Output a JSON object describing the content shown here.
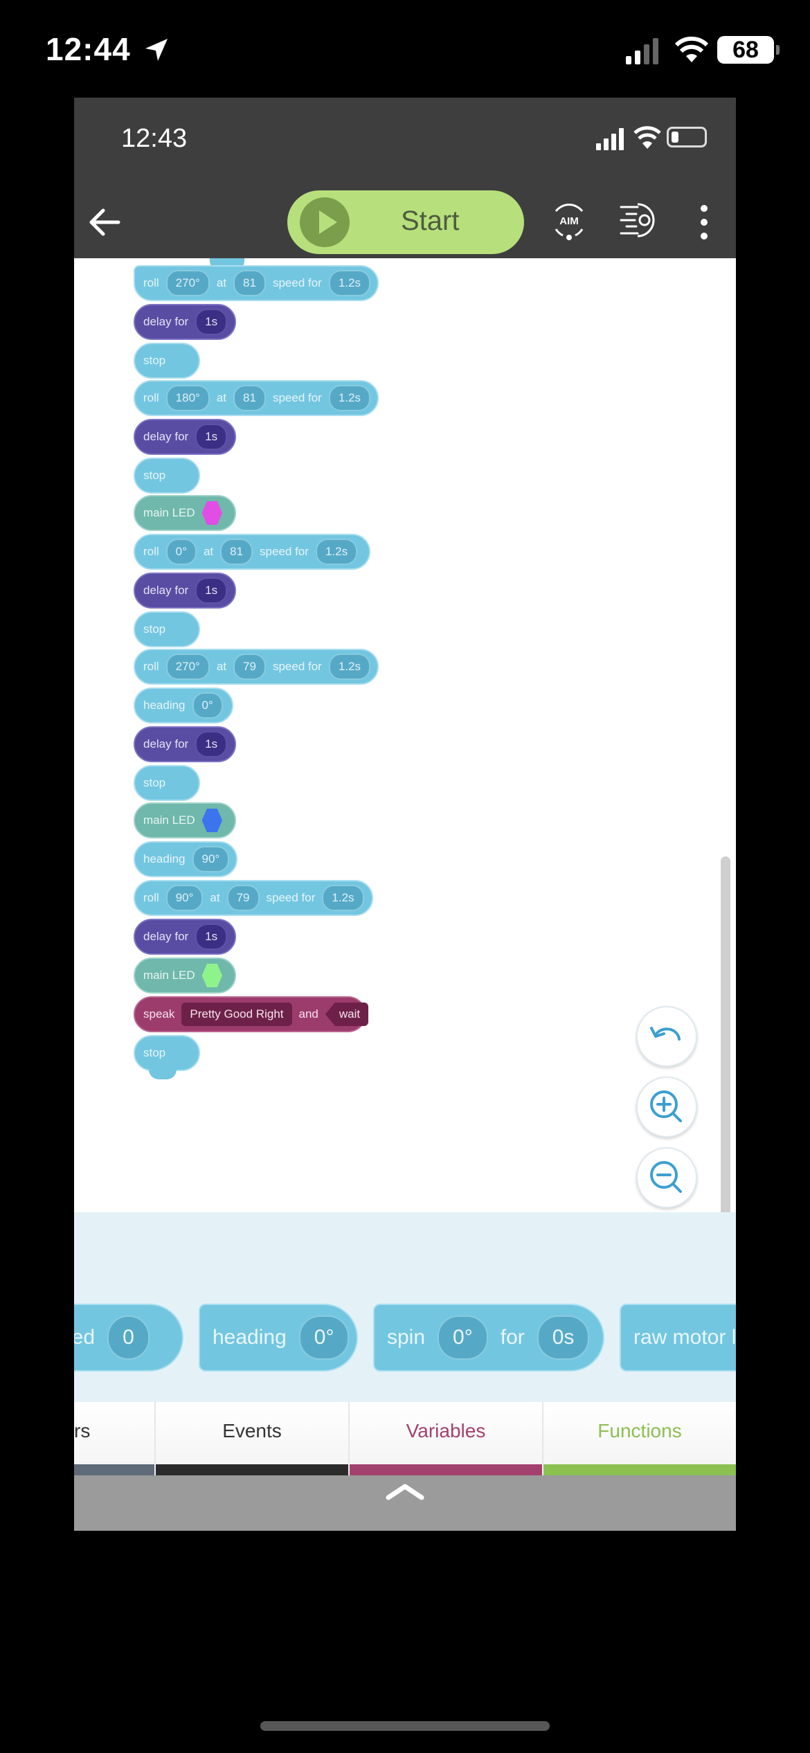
{
  "device_status": {
    "time": "12:44",
    "battery": "68",
    "location_icon": "location-arrow-icon",
    "signal_icon": "cell-signal-icon",
    "wifi_icon": "wifi-icon"
  },
  "app_status": {
    "time": "12:43"
  },
  "toolbar": {
    "back_icon": "back-arrow-icon",
    "start_label": "Start",
    "aim_label": "AIM",
    "gauge_icon": "sensor-gauge-icon",
    "more_icon": "more-vertical-icon"
  },
  "colors": {
    "roll": "#73c6e0",
    "delay": "#584ca3",
    "led": "#6fb8ab",
    "speak": "#9c3c6c",
    "led_magenta": "#e24de6",
    "led_blue": "#3b74ee",
    "led_green": "#8ff38c",
    "variables": "#a3416e",
    "functions": "#8cc051"
  },
  "blocks": [
    {
      "kind": "roll",
      "label": "roll",
      "heading": "270°",
      "at": "at",
      "speed": "81",
      "speed_label": "speed for",
      "duration": "1.2s"
    },
    {
      "kind": "delay",
      "label": "delay for",
      "value": "1s"
    },
    {
      "kind": "stop",
      "label": "stop"
    },
    {
      "kind": "roll",
      "label": "roll",
      "heading": "180°",
      "at": "at",
      "speed": "81",
      "speed_label": "speed for",
      "duration": "1.2s"
    },
    {
      "kind": "delay",
      "label": "delay for",
      "value": "1s"
    },
    {
      "kind": "stop",
      "label": "stop"
    },
    {
      "kind": "led",
      "label": "main LED",
      "color": "#e24de6"
    },
    {
      "kind": "roll",
      "label": "roll",
      "heading": "0°",
      "at": "at",
      "speed": "81",
      "speed_label": "speed for",
      "duration": "1.2s"
    },
    {
      "kind": "delay",
      "label": "delay for",
      "value": "1s"
    },
    {
      "kind": "stop",
      "label": "stop"
    },
    {
      "kind": "roll",
      "label": "roll",
      "heading": "270°",
      "at": "at",
      "speed": "79",
      "speed_label": "speed for",
      "duration": "1.2s"
    },
    {
      "kind": "heading",
      "label": "heading",
      "value": "0°"
    },
    {
      "kind": "delay",
      "label": "delay for",
      "value": "1s"
    },
    {
      "kind": "stop",
      "label": "stop"
    },
    {
      "kind": "led",
      "label": "main LED",
      "color": "#3b74ee"
    },
    {
      "kind": "heading",
      "label": "heading",
      "value": "90°"
    },
    {
      "kind": "roll",
      "label": "roll",
      "heading": "90°",
      "at": "at",
      "speed": "79",
      "speed_label": "speed for",
      "duration": "1.2s"
    },
    {
      "kind": "delay",
      "label": "delay for",
      "value": "1s"
    },
    {
      "kind": "led",
      "label": "main LED",
      "color": "#8ff38c"
    },
    {
      "kind": "speak",
      "label": "speak",
      "text": "Pretty Good Right",
      "and": "and",
      "wait": "wait"
    },
    {
      "kind": "stop",
      "label": "stop"
    }
  ],
  "canvas_controls": {
    "undo_icon": "undo-icon",
    "zoom_in_icon": "zoom-in-icon",
    "zoom_out_icon": "zoom-out-icon"
  },
  "palette": [
    {
      "label": "eed",
      "value": "0"
    },
    {
      "label": "heading",
      "value": "0°"
    },
    {
      "label": "spin",
      "value": "0°",
      "for": "for",
      "value2": "0s"
    },
    {
      "label": "raw motor le"
    }
  ],
  "tabs": [
    {
      "label": "rs",
      "color": "#5f6b78"
    },
    {
      "label": "Events",
      "color": "#2b2b2b"
    },
    {
      "label": "Variables",
      "color": "#a3416e"
    },
    {
      "label": "Functions",
      "color": "#8cc051"
    }
  ],
  "footer": {
    "expand_icon": "chevron-up-icon"
  }
}
